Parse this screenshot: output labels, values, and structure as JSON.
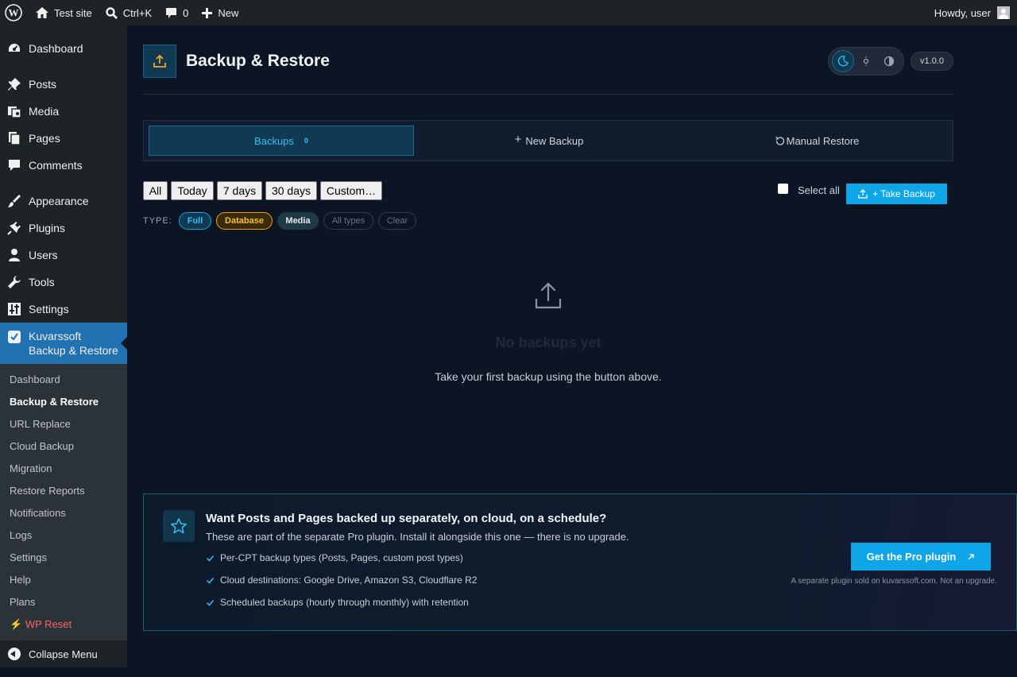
{
  "adminbar": {
    "site_name": "Test site",
    "search_shortcut": "Ctrl+K",
    "comments_count": "0",
    "new_label": "New",
    "greeting": "Howdy, user"
  },
  "sidebar": {
    "items": [
      {
        "label": "Dashboard",
        "icon": "dashboard-icon"
      },
      {
        "label": "Posts",
        "icon": "pin-icon"
      },
      {
        "label": "Media",
        "icon": "media-icon"
      },
      {
        "label": "Pages",
        "icon": "pages-icon"
      },
      {
        "label": "Comments",
        "icon": "comment-icon"
      },
      {
        "label": "Appearance",
        "icon": "brush-icon"
      },
      {
        "label": "Plugins",
        "icon": "plugin-icon"
      },
      {
        "label": "Users",
        "icon": "user-icon"
      },
      {
        "label": "Tools",
        "icon": "wrench-icon"
      },
      {
        "label": "Settings",
        "icon": "sliders-icon"
      }
    ],
    "active_line1": "Kuvarssoft",
    "active_line2": "Backup & Restore",
    "submenu": [
      "Dashboard",
      "Backup & Restore",
      "URL Replace",
      "Cloud Backup",
      "Migration",
      "Restore Reports",
      "Notifications",
      "Logs",
      "Settings",
      "Help",
      "Plans",
      "WP Reset"
    ],
    "reset_glyph": "⚡",
    "collapse_label": "Collapse Menu"
  },
  "header": {
    "title": "Backup & Restore",
    "version": "v1.0.0"
  },
  "tabs": [
    {
      "label": "Backups",
      "count": "0"
    },
    {
      "label": "New Backup",
      "glyph": "+"
    },
    {
      "label": "Manual Restore"
    }
  ],
  "filters": {
    "date_buttons": [
      "All",
      "Today",
      "7 days",
      "30 days",
      "Custom…"
    ],
    "select_all_label": "Select all",
    "take_backup_label": "+ Take Backup",
    "type_label": "TYPE:",
    "chips": [
      "Full",
      "Database",
      "Media",
      "All types",
      "Clear"
    ]
  },
  "empty_state": {
    "title": "No backups yet",
    "text": "Take your first backup using the button above."
  },
  "promo": {
    "title": "Want Posts and Pages backed up separately, on cloud, on a schedule?",
    "subtitle": "These are part of the separate Pro plugin. Install it alongside this one — there is no upgrade.",
    "features": [
      "Per-CPT backup types (Posts, Pages, custom post types)",
      "Cloud destinations: Google Drive, Amazon S3, Cloudflare R2",
      "Scheduled backups (hourly through monthly) with retention"
    ],
    "button_label": "Get the Pro plugin",
    "note": "A separate plugin sold on kuvarssoft.com. Not an upgrade."
  },
  "colors": {
    "accent": "#0ea5e9",
    "menu_active": "#2271b1",
    "database_chip": "#f59e0b",
    "page_bg": "#0b1524"
  }
}
